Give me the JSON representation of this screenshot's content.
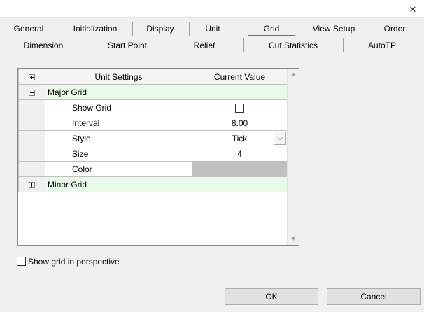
{
  "window": {
    "close_glyph": "✕"
  },
  "tabs_row1": [
    {
      "label": "General"
    },
    {
      "label": "Initialization"
    },
    {
      "label": "Display"
    },
    {
      "label": "Unit"
    },
    {
      "label": "Grid",
      "selected": true
    },
    {
      "label": "View Setup"
    },
    {
      "label": "Order"
    }
  ],
  "tabs_row2": [
    {
      "label": "Dimension"
    },
    {
      "label": "Start Point"
    },
    {
      "label": "Relief"
    },
    {
      "label": "Cut Statistics"
    },
    {
      "label": "AutoTP"
    }
  ],
  "grid": {
    "col_settings": "Unit Settings",
    "col_value": "Current Value",
    "major_group": "Major Grid",
    "rows": {
      "show_grid": {
        "label": "Show Grid",
        "checked": false
      },
      "interval": {
        "label": "Interval",
        "value": "8.00"
      },
      "style": {
        "label": "Style",
        "value": "Tick"
      },
      "size": {
        "label": "Size",
        "value": "4"
      },
      "color": {
        "label": "Color",
        "value_color": "#c0c0c0"
      }
    },
    "minor_group": "Minor Grid"
  },
  "options": {
    "show_grid_perspective": "Show grid in perspective"
  },
  "buttons": {
    "ok": "OK",
    "cancel": "Cancel"
  },
  "colors": {
    "group_bg": "#e8fbe8",
    "panel_bg": "#f0f0f0"
  }
}
